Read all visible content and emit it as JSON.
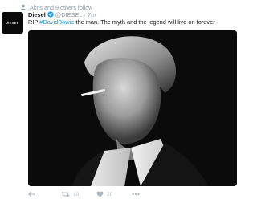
{
  "context": {
    "text": "Akris and 9 others follow",
    "icon": "person-icon"
  },
  "author": {
    "avatar_text": "DIESEL",
    "name": "Diesel",
    "handle": "@DIESEL",
    "separator": "·",
    "time": "7m",
    "verified_icon": "verified-badge-icon"
  },
  "tweet": {
    "prefix": "RIP ",
    "hashtag": "#DavidBowie",
    "suffix": " the man. The myth and the legend will live on forever"
  },
  "media": {
    "description_icon": "black-and-white-portrait-photo"
  },
  "actions": {
    "retweet_count": "10",
    "like_count": "20"
  },
  "colors": {
    "link": "#1b95e0",
    "muted": "#8899a6",
    "action": "#aab8c2",
    "verified": "#1da1f2"
  }
}
